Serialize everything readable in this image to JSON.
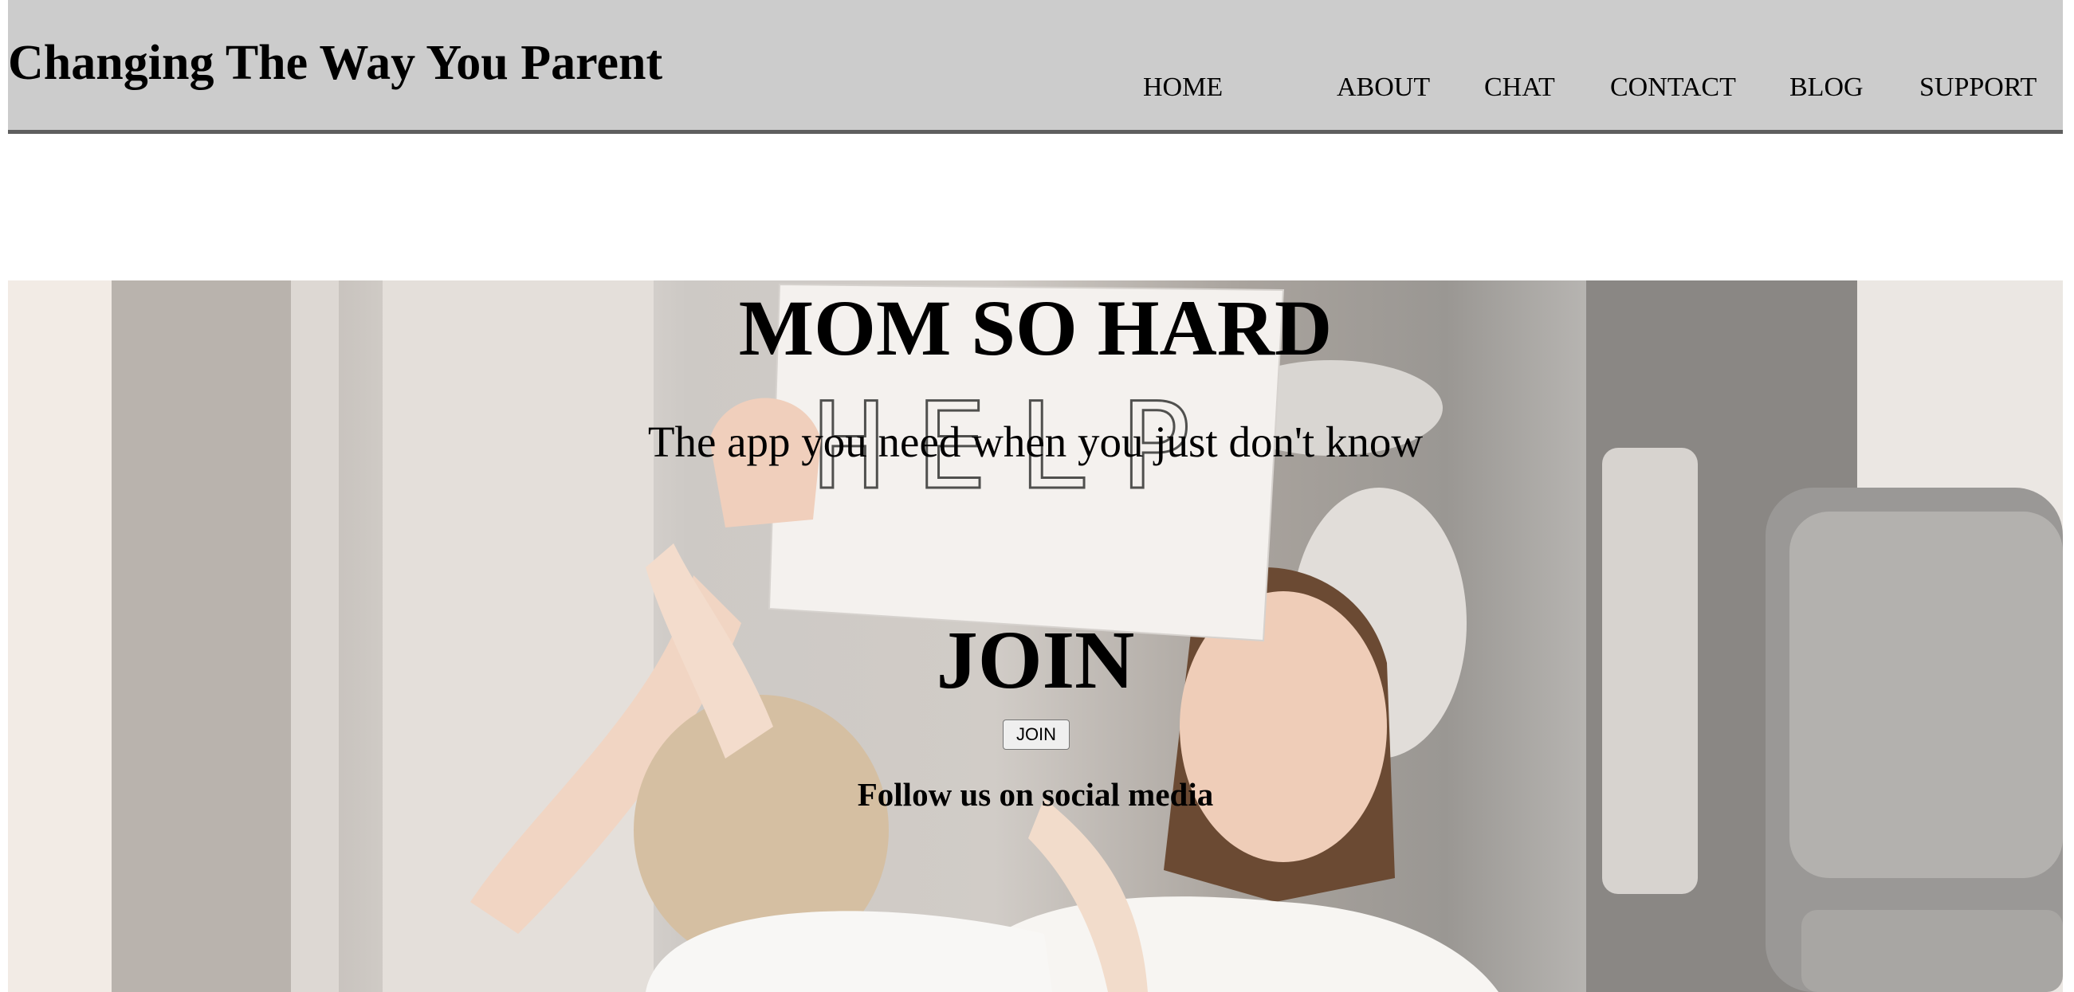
{
  "header": {
    "site_title": "Changing The Way You Parent",
    "nav": [
      {
        "label": "HOME"
      },
      {
        "label": "ABOUT"
      },
      {
        "label": "CHAT"
      },
      {
        "label": "CONTACT"
      },
      {
        "label": "BLOG"
      },
      {
        "label": "SUPPORT"
      }
    ]
  },
  "hero": {
    "title": "MOM SO HARD",
    "subtitle": "The app you need when you just don't know",
    "sign_text": "HELP",
    "join_heading": "JOIN",
    "join_button_label": "JOIN",
    "social_heading": "Follow us on social media"
  },
  "colors": {
    "header_bg": "#cccccc",
    "header_border": "#5f5f5f",
    "page_bg": "#ffffff",
    "button_bg": "#efefef"
  }
}
